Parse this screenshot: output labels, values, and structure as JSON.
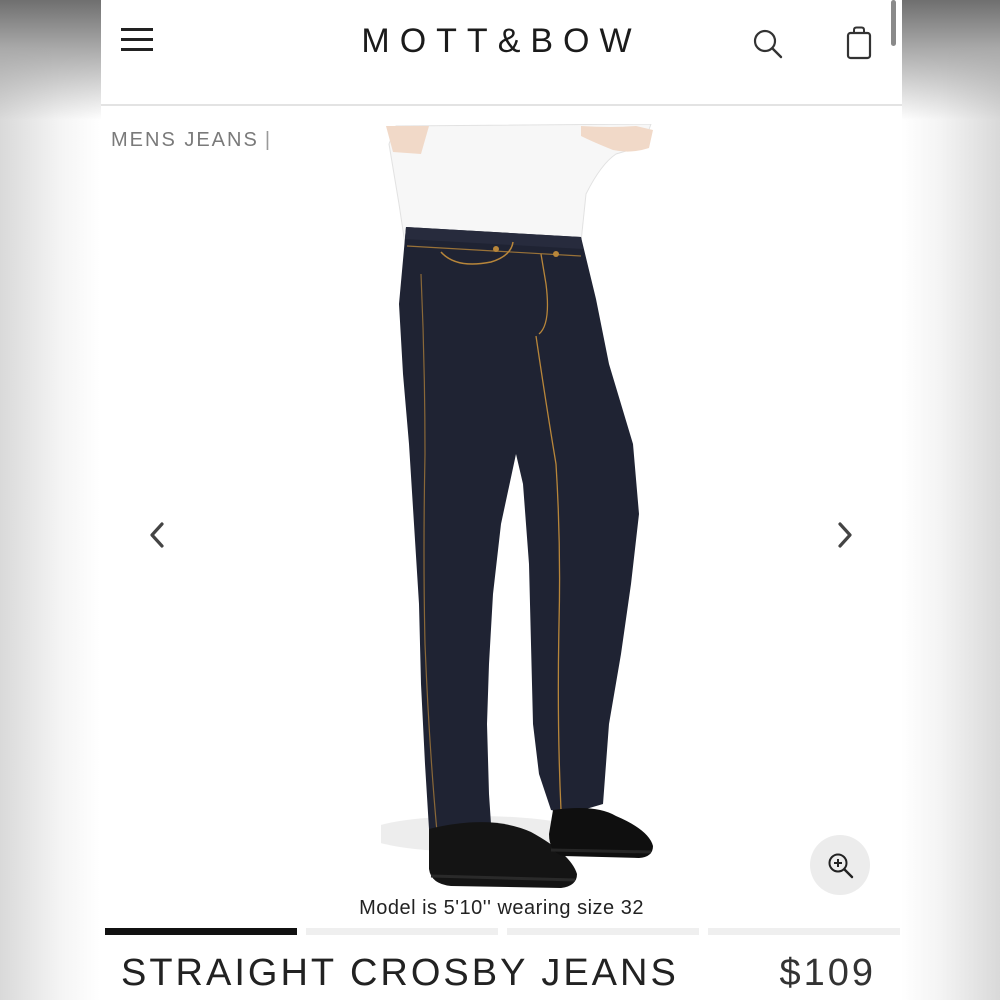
{
  "header": {
    "brand": "MOTT&BOW",
    "icons": [
      "hamburger-menu-icon",
      "search-icon",
      "shopping-bag-icon"
    ]
  },
  "breadcrumb": {
    "category": "MENS JEANS",
    "separator": "|"
  },
  "gallery": {
    "caption": "Model is 5'10'' wearing size 32",
    "slide_count": 4,
    "active_slide": 1,
    "icons": [
      "chevron-left-icon",
      "chevron-right-icon",
      "zoom-in-icon"
    ]
  },
  "product": {
    "title": "STRAIGHT CROSBY JEANS",
    "price": "$109"
  },
  "colors": {
    "denim": "#1f2333",
    "stitching": "#b8863a",
    "text": "#222222",
    "pager_active": "#111111",
    "pager_inactive": "#efefef"
  }
}
